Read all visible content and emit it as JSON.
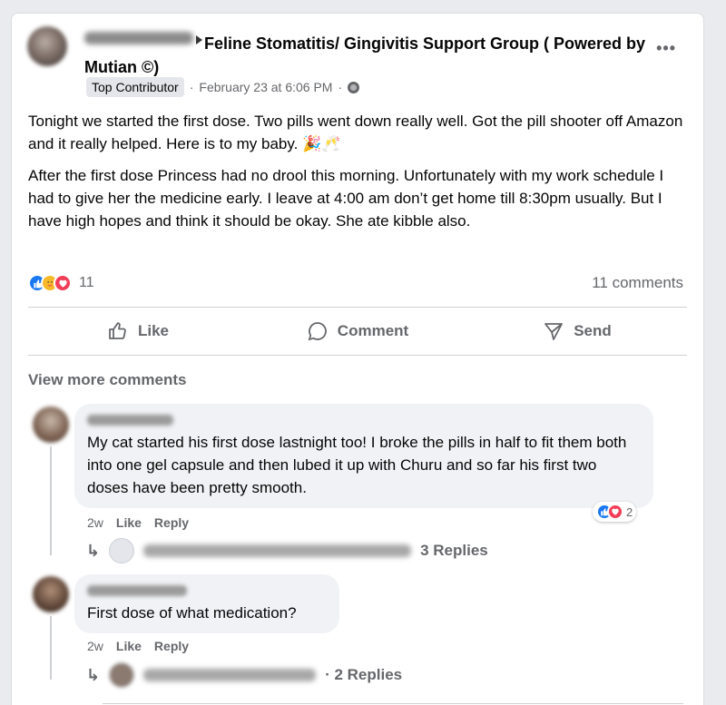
{
  "post": {
    "group_name": "Feline Stomatitis/ Gingivitis Support Group ( Powered by Mutian ©)",
    "badge": "Top Contributor",
    "meta_sep": "·",
    "date": "February 23 at 6:06 PM",
    "meta_sep2": "·",
    "more_label": "•••",
    "paragraph1": "Tonight we started the first dose. Two pills went down really well. Got the pill shooter off Amazon and it really helped. Here is to my baby. 🎉🥂",
    "paragraph2": "After the first dose Princess had no drool this morning. Unfortunately with my work schedule I had to give her the medicine early. I leave at 4:00 am don’t get home till 8:30pm usually. But I have high hopes and think it should be okay. She ate kibble also.",
    "reaction_count": "11",
    "comments_count": "11 comments"
  },
  "actions": {
    "like": "Like",
    "comment": "Comment",
    "send": "Send"
  },
  "view_more": "View more comments",
  "comments": [
    {
      "text": "My cat started his first dose lastnight too! I broke the pills in half to fit them both into one gel capsule and then lubed it up with Churu and so far his first two doses have been pretty smooth.",
      "time": "2w",
      "like": "Like",
      "reply": "Reply",
      "reaction_count": "2",
      "replies_label": "3 Replies"
    },
    {
      "text": "First dose of what medication?",
      "time": "2w",
      "like": "Like",
      "reply": "Reply",
      "replies_label": "· 2 Replies"
    }
  ],
  "colors": {
    "like_blue": "#1877f2",
    "love_red": "#f33e58",
    "care_yellow": "#f7b928",
    "secondary_text": "#65676b"
  }
}
